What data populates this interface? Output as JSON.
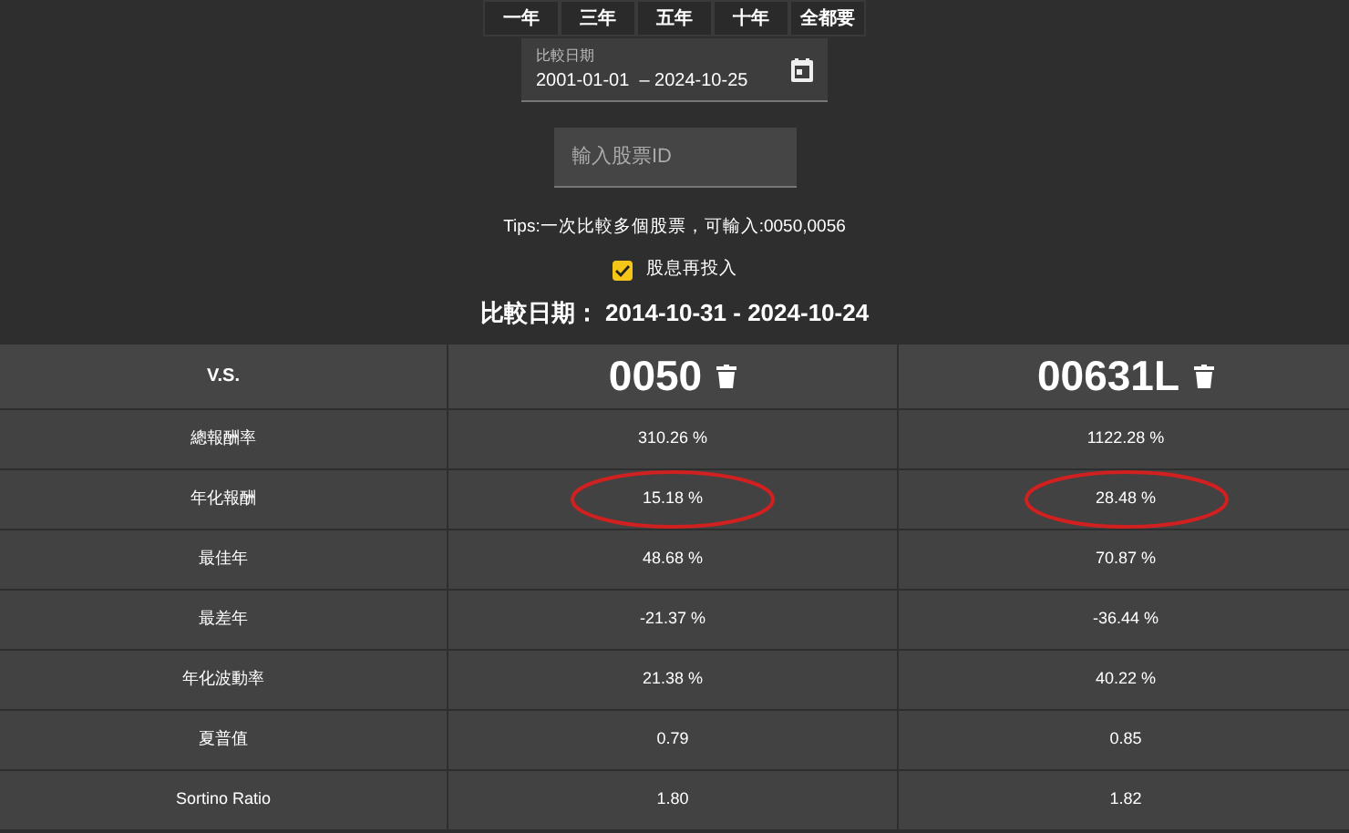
{
  "range_buttons": [
    "一年",
    "三年",
    "五年",
    "十年",
    "全都要"
  ],
  "date_field": {
    "label": "比較日期",
    "value": "2001-01-01  – 2024-10-25"
  },
  "stock_input": {
    "placeholder": "輸入股票ID"
  },
  "tips": "Tips:一次比較多個股票，可輸入:0050,0056",
  "dividend_reinvest": {
    "label": "股息再投入",
    "checked": true
  },
  "compare_title": "比較日期： 2014-10-31 - 2024-10-24",
  "table": {
    "header": "V.S.",
    "stocks": [
      "0050",
      "00631L"
    ],
    "rows": [
      {
        "label": "總報酬率",
        "values": [
          "310.26 %",
          "1122.28 %"
        ],
        "circled": false
      },
      {
        "label": "年化報酬",
        "values": [
          "15.18 %",
          "28.48 %"
        ],
        "circled": true
      },
      {
        "label": "最佳年",
        "values": [
          "48.68 %",
          "70.87 %"
        ],
        "circled": false
      },
      {
        "label": "最差年",
        "values": [
          "-21.37 %",
          "-36.44 %"
        ],
        "circled": false
      },
      {
        "label": "年化波動率",
        "values": [
          "21.38 %",
          "40.22 %"
        ],
        "circled": false
      },
      {
        "label": "夏普值",
        "values": [
          "0.79",
          "0.85"
        ],
        "circled": false
      },
      {
        "label": "Sortino Ratio",
        "values": [
          "1.80",
          "1.82"
        ],
        "circled": false
      }
    ]
  }
}
